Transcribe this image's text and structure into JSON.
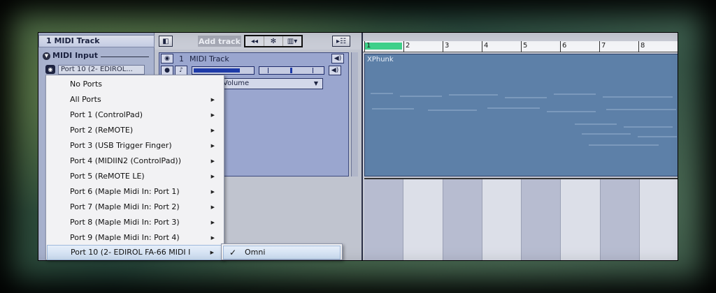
{
  "inspector": {
    "track_title": "1   MIDI Track",
    "section_label": "MIDI Input",
    "section_icon": "chevron-down-icon",
    "port_field": "Port 10 (2- EDIROL...",
    "port_icon": "midi-port-icon"
  },
  "toolbar": {
    "toggle_inspector_icon": "panel-toggle-icon",
    "add_track_label": "Add track",
    "group_icons": [
      "arrow-left-icon",
      "gear-icon",
      "keyboard-dropdown-icon"
    ],
    "track_view_icon": "track-view-icon"
  },
  "track": {
    "number": "1",
    "name": "MIDI Track",
    "automation_label": "Volume",
    "volume_level": 0.78
  },
  "clip": {
    "name": "XPhunk"
  },
  "ruler": {
    "marks": [
      "1",
      "2",
      "3",
      "4",
      "5",
      "6",
      "7",
      "8"
    ]
  },
  "menu": {
    "items": [
      {
        "label": "No Ports",
        "has_submenu": false
      },
      {
        "label": "All Ports",
        "has_submenu": true
      },
      {
        "label": "Port 1 (ControlPad)",
        "has_submenu": true
      },
      {
        "label": "Port 2 (ReMOTE)",
        "has_submenu": true
      },
      {
        "label": "Port 3 (USB Trigger Finger)",
        "has_submenu": true
      },
      {
        "label": "Port 4 (MIDIIN2 (ControlPad))",
        "has_submenu": true
      },
      {
        "label": "Port 5 (ReMOTE LE)",
        "has_submenu": true
      },
      {
        "label": "Port 6 (Maple Midi In: Port 1)",
        "has_submenu": true
      },
      {
        "label": "Port 7 (Maple Midi In: Port 2)",
        "has_submenu": true
      },
      {
        "label": "Port 8 (Maple Midi In: Port 3)",
        "has_submenu": true
      },
      {
        "label": "Port 9 (Maple Midi In: Port 4)",
        "has_submenu": true
      },
      {
        "label": "Port 10 (2- EDIROL FA-66 MIDI I",
        "has_submenu": true,
        "highlighted": true
      }
    ],
    "submenu": {
      "item_label": "Omni",
      "checked": true
    }
  }
}
